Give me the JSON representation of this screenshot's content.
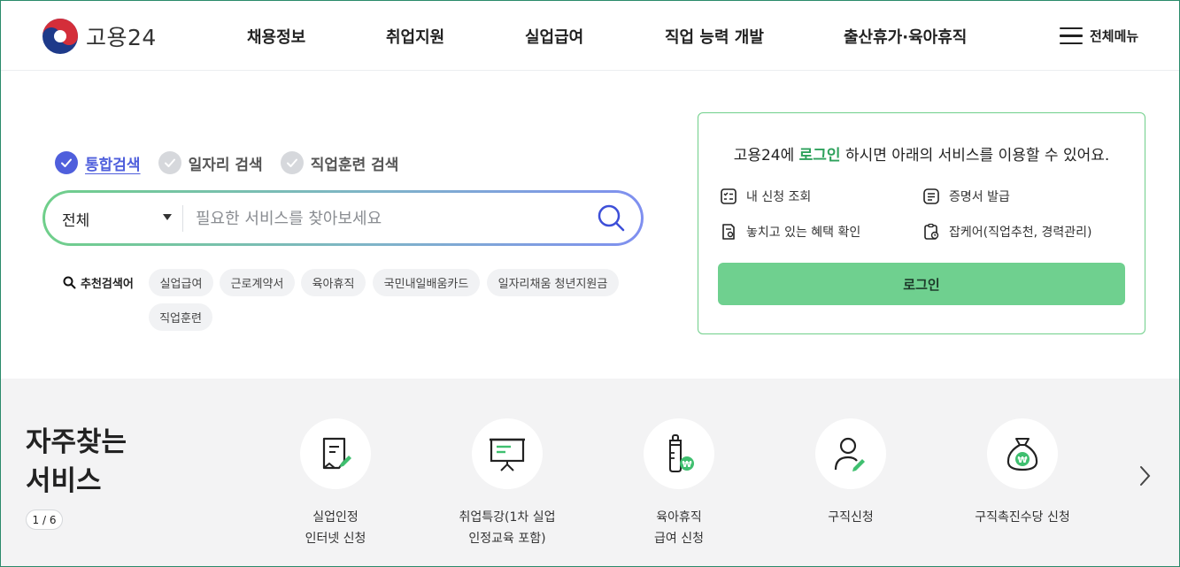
{
  "header": {
    "logo_text": "고용24",
    "nav": [
      "채용정보",
      "취업지원",
      "실업급여",
      "직업 능력 개발",
      "출산휴가·육아휴직"
    ],
    "all_menu_label": "전체메뉴"
  },
  "search": {
    "tabs": [
      "통합검색",
      "일자리 검색",
      "직업훈련 검색"
    ],
    "scope": "전체",
    "placeholder": "필요한 서비스를 찾아보세요",
    "recommended_label": "추천검색어",
    "keywords": [
      "실업급여",
      "근로계약서",
      "육아휴직",
      "국민내일배움카드",
      "일자리채움 청년지원금",
      "직업훈련"
    ]
  },
  "login_panel": {
    "msg_prefix": "고용24에 ",
    "msg_highlight": "로그인",
    "msg_suffix": " 하시면 아래의 서비스를 이용할 수 있어요.",
    "services": [
      "내 신청 조회",
      "증명서 발급",
      "놓치고 있는 혜택 확인",
      "잡케어(직업추천, 경력관리)"
    ],
    "login_button": "로그인"
  },
  "frequent": {
    "title_line1": "자주찾는",
    "title_line2": "서비스",
    "pager": "1 / 6",
    "items": [
      {
        "name": "실업인정\n인터넷 신청",
        "icon": "document-pen-icon"
      },
      {
        "name": "취업특강(1차 실업\n인정교육 포함)",
        "icon": "presentation-board-icon"
      },
      {
        "name": "육아휴직\n급여 신청",
        "icon": "baby-bottle-won-icon"
      },
      {
        "name": "구직신청",
        "icon": "person-pen-icon"
      },
      {
        "name": "구직촉진수당 신청",
        "icon": "money-bag-won-icon"
      }
    ]
  },
  "colors": {
    "accent_blue": "#4f5fdc",
    "accent_green": "#2ea15c",
    "login_button": "#6fd08f"
  }
}
